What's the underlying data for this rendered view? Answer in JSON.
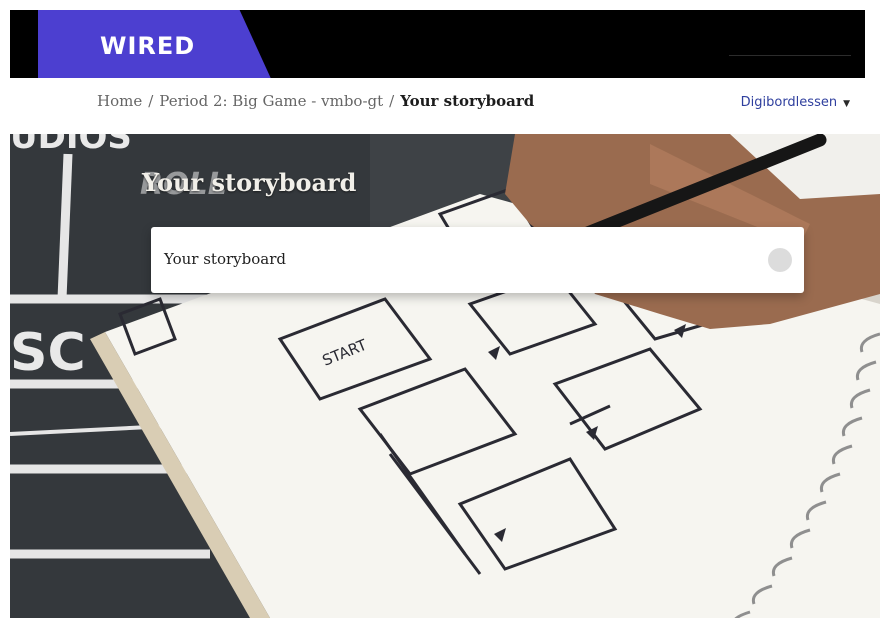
{
  "header": {
    "logo_text": "WIRED",
    "brand_color": "#4c3fd0"
  },
  "breadcrumb": {
    "items": [
      "Home",
      "Period 2: Big Game - vmbo-gt"
    ],
    "current": "Your storyboard",
    "separator": "/"
  },
  "language_menu": {
    "label": "Digibordlessen",
    "caret": "▼"
  },
  "hero": {
    "title": "Your storyboard"
  },
  "activity": {
    "name": "Your storyboard",
    "completion_icon": "completion-circle-icon"
  }
}
